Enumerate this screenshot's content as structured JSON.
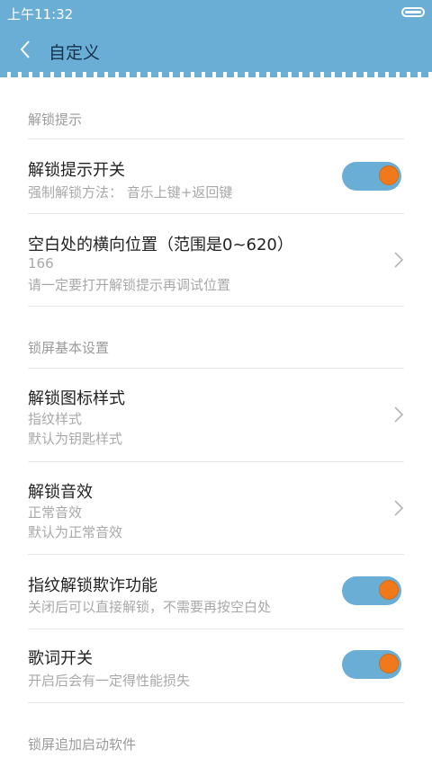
{
  "status": {
    "time": "上午11:32"
  },
  "appbar": {
    "title": "自定义"
  },
  "sections": [
    {
      "header": "解锁提示"
    },
    {
      "header": "锁屏基本设置"
    },
    {
      "header": "锁屏追加启动软件"
    }
  ],
  "items": [
    {
      "title": "解锁提示开关",
      "subtitle": "强制解锁方法： 音乐上键+返回键",
      "toggle": true
    },
    {
      "title": "空白处的横向位置（范围是0~620）",
      "value": "166",
      "subtitle": "请一定要打开解锁提示再调试位置"
    },
    {
      "title": "解锁图标样式",
      "value": "指纹样式",
      "subtitle": "默认为钥匙样式"
    },
    {
      "title": "解锁音效",
      "value": "正常音效",
      "subtitle": "默认为正常音效"
    },
    {
      "title": "指纹解锁欺诈功能",
      "subtitle": "关闭后可以直接解锁，不需要再按空白处",
      "toggle": true
    },
    {
      "title": "歌词开关",
      "subtitle": "开启后会有一定得性能损失",
      "toggle": true
    }
  ],
  "colors": {
    "accent": "#6aaed6",
    "knob": "#f07a1b"
  }
}
